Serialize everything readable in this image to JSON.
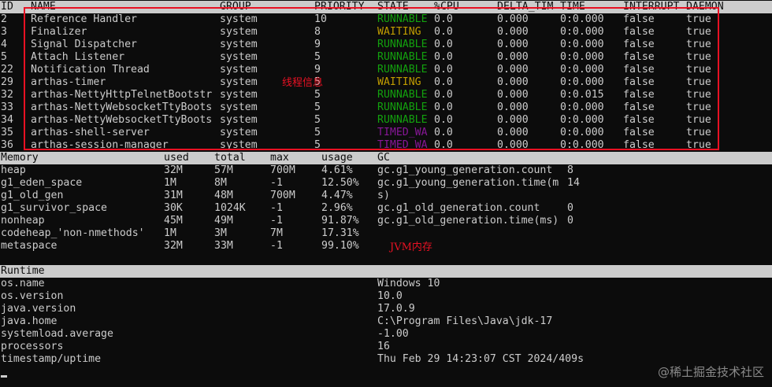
{
  "thread_table": {
    "headers": [
      "ID",
      "NAME",
      "GROUP",
      "PRIORITY",
      "STATE",
      "%CPU",
      "DELTA_TIM",
      "TIME",
      "INTERRUPT",
      "DAEMON"
    ],
    "rows": [
      {
        "id": "2",
        "name": "Reference Handler",
        "group": "system",
        "priority": "10",
        "state": "RUNNABLE",
        "cpu": "0.0",
        "delta": "0.000",
        "time": "0:0.000",
        "interrupt": "false",
        "daemon": "true"
      },
      {
        "id": "3",
        "name": "Finalizer",
        "group": "system",
        "priority": "8",
        "state": "WAITING",
        "cpu": "0.0",
        "delta": "0.000",
        "time": "0:0.000",
        "interrupt": "false",
        "daemon": "true"
      },
      {
        "id": "4",
        "name": "Signal Dispatcher",
        "group": "system",
        "priority": "9",
        "state": "RUNNABLE",
        "cpu": "0.0",
        "delta": "0.000",
        "time": "0:0.000",
        "interrupt": "false",
        "daemon": "true"
      },
      {
        "id": "5",
        "name": "Attach Listener",
        "group": "system",
        "priority": "5",
        "state": "RUNNABLE",
        "cpu": "0.0",
        "delta": "0.000",
        "time": "0:0.000",
        "interrupt": "false",
        "daemon": "true"
      },
      {
        "id": "22",
        "name": "Notification Thread",
        "group": "system",
        "priority": "9",
        "state": "RUNNABLE",
        "cpu": "0.0",
        "delta": "0.000",
        "time": "0:0.000",
        "interrupt": "false",
        "daemon": "true"
      },
      {
        "id": "29",
        "name": "arthas-timer",
        "group": "system",
        "priority": "5",
        "state": "WAITING",
        "cpu": "0.0",
        "delta": "0.000",
        "time": "0:0.000",
        "interrupt": "false",
        "daemon": "true"
      },
      {
        "id": "32",
        "name": "arthas-NettyHttpTelnetBootstr",
        "group": "system",
        "priority": "5",
        "state": "RUNNABLE",
        "cpu": "0.0",
        "delta": "0.000",
        "time": "0:0.015",
        "interrupt": "false",
        "daemon": "true"
      },
      {
        "id": "33",
        "name": "arthas-NettyWebsocketTtyBoots",
        "group": "system",
        "priority": "5",
        "state": "RUNNABLE",
        "cpu": "0.0",
        "delta": "0.000",
        "time": "0:0.000",
        "interrupt": "false",
        "daemon": "true"
      },
      {
        "id": "34",
        "name": "arthas-NettyWebsocketTtyBoots",
        "group": "system",
        "priority": "5",
        "state": "RUNNABLE",
        "cpu": "0.0",
        "delta": "0.000",
        "time": "0:0.000",
        "interrupt": "false",
        "daemon": "true"
      },
      {
        "id": "35",
        "name": "arthas-shell-server",
        "group": "system",
        "priority": "5",
        "state": "TIMED_WA",
        "cpu": "0.0",
        "delta": "0.000",
        "time": "0:0.000",
        "interrupt": "false",
        "daemon": "true"
      },
      {
        "id": "36",
        "name": "arthas-session-manager",
        "group": "system",
        "priority": "5",
        "state": "TIMED_WA",
        "cpu": "0.0",
        "delta": "0.000",
        "time": "0:0.000",
        "interrupt": "false",
        "daemon": "true"
      }
    ],
    "annotation": "线程信息"
  },
  "memory_table": {
    "headers": [
      "Memory",
      "used",
      "total",
      "max",
      "usage",
      "GC"
    ],
    "rows": [
      {
        "name": "heap",
        "used": "32M",
        "total": "57M",
        "max": "700M",
        "usage": "4.61%",
        "gc_name": "gc.g1_young_generation.count",
        "gc_value": "8"
      },
      {
        "name": "g1_eden_space",
        "used": "1M",
        "total": "8M",
        "max": "-1",
        "usage": "12.50%",
        "gc_name": "gc.g1_young_generation.time(m",
        "gc_value": "14"
      },
      {
        "name": "g1_old_gen",
        "used": "31M",
        "total": "48M",
        "max": "700M",
        "usage": "4.47%",
        "gc_name": "s)",
        "gc_value": ""
      },
      {
        "name": "g1_survivor_space",
        "used": "30K",
        "total": "1024K",
        "max": "-1",
        "usage": "2.96%",
        "gc_name": "gc.g1_old_generation.count",
        "gc_value": "0"
      },
      {
        "name": "nonheap",
        "used": "45M",
        "total": "49M",
        "max": "-1",
        "usage": "91.87%",
        "gc_name": "gc.g1_old_generation.time(ms)",
        "gc_value": "0"
      },
      {
        "name": "codeheap_'non-nmethods'",
        "used": "1M",
        "total": "3M",
        "max": "7M",
        "usage": "17.31%",
        "gc_name": "",
        "gc_value": ""
      },
      {
        "name": "metaspace",
        "used": "32M",
        "total": "33M",
        "max": "-1",
        "usage": "99.10%",
        "gc_name": "",
        "gc_value": ""
      }
    ],
    "annotation": "JVM内存"
  },
  "runtime_table": {
    "header": "Runtime",
    "rows": [
      {
        "key": "os.name",
        "value": "Windows 10"
      },
      {
        "key": "os.version",
        "value": "10.0"
      },
      {
        "key": "java.version",
        "value": "17.0.9"
      },
      {
        "key": "java.home",
        "value": "C:\\Program Files\\Java\\jdk-17"
      },
      {
        "key": "systemload.average",
        "value": "-1.00"
      },
      {
        "key": "processors",
        "value": "16"
      },
      {
        "key": "timestamp/uptime",
        "value": "Thu Feb 29 14:23:07 CST 2024/409s"
      }
    ]
  },
  "watermark": "@稀土掘金技术社区",
  "colors": {
    "background": "#0c0c0c",
    "text": "#cccccc",
    "header_bar": "#cccccc",
    "state_runnable": "#13a10e",
    "state_waiting": "#c19c00",
    "state_timed_waiting": "#881798",
    "annotation": "#e81123"
  }
}
